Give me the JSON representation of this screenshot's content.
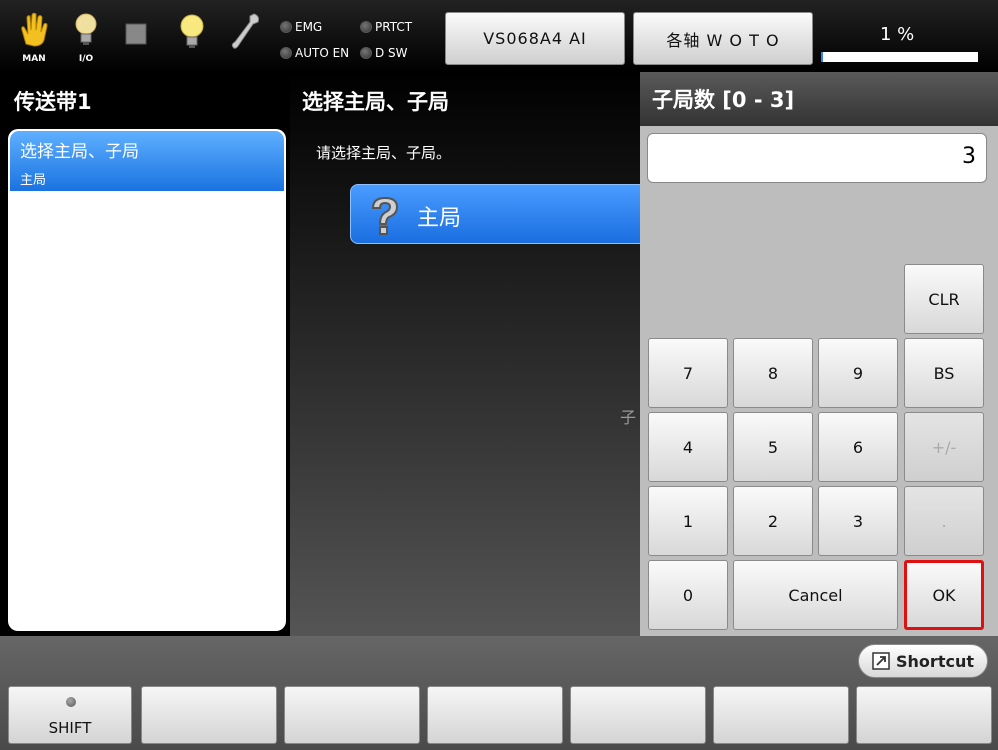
{
  "topbar": {
    "man_label": "MAN",
    "io_label": "I/O",
    "leds": {
      "emg": "EMG",
      "prtct": "PRTCT",
      "auto_en": "AUTO EN",
      "dsw": "D SW"
    },
    "robot_button": "VS068A4 AI",
    "axis_button": "各轴 W O T O",
    "progress_text": "1 %",
    "progress_value": 0.01
  },
  "left_panel": {
    "title": "传送带1",
    "selected_item": {
      "title": "选择主局、子局",
      "subtitle": "主局"
    }
  },
  "main": {
    "title": "选择主局、子局",
    "prompt": "请选择主局、子局。",
    "option_label": "主局",
    "option_icon": "question-mark-icon",
    "partial_text": "子"
  },
  "keypad": {
    "title": "子局数 [0 - 3]",
    "value": "3",
    "keys": {
      "clr": "CLR",
      "k7": "7",
      "k8": "8",
      "k9": "9",
      "bs": "BS",
      "k4": "4",
      "k5": "5",
      "k6": "6",
      "sign": "+/-",
      "k1": "1",
      "k2": "2",
      "k3": "3",
      "dot": ".",
      "k0": "0",
      "cancel": "Cancel",
      "ok": "OK"
    },
    "ok_highlight_color": "#e01010"
  },
  "bottom": {
    "shortcut_label": "Shortcut",
    "shift_label": "SHIFT",
    "function_keys": [
      "",
      "",
      "",
      "",
      "",
      ""
    ]
  },
  "colors": {
    "selection_blue": "#1a73e0",
    "panel_gray": "#bdbdbd"
  }
}
